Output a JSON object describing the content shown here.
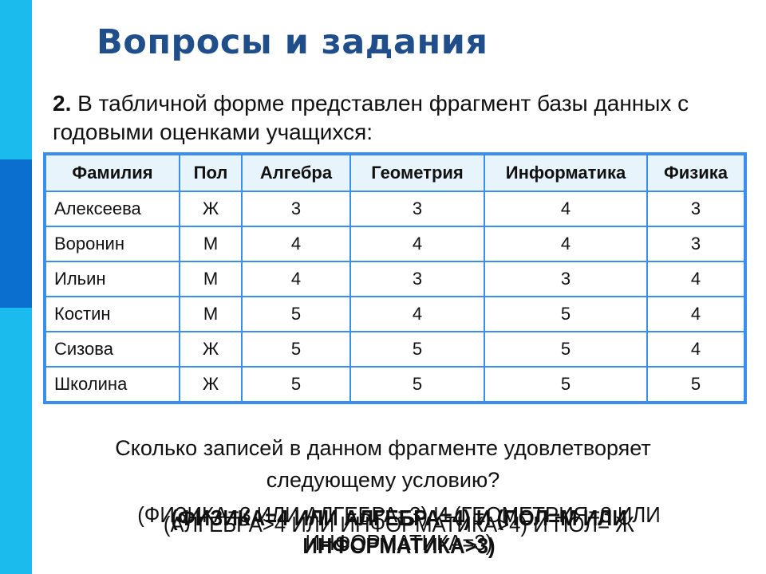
{
  "slide": {
    "title": "Вопросы и задания",
    "task_number": "2.",
    "task_text": " В табличной форме представлен фрагмент базы данных с годовыми оценками учащихся:"
  },
  "colors": {
    "side_bar": "#1cbbee",
    "side_block": "#0a6fce",
    "title": "#1f4e8a",
    "table_border": "#3a8ef0",
    "table_header_bg": "#e8f4fc"
  },
  "table": {
    "headers": [
      "Фамилия",
      "Пол",
      "Алгебра",
      "Геометрия",
      "Информатика",
      "Физика"
    ],
    "rows": [
      [
        "Алексеева",
        "Ж",
        "3",
        "3",
        "4",
        "3"
      ],
      [
        "Воронин",
        "М",
        "4",
        "4",
        "4",
        "3"
      ],
      [
        "Ильин",
        "М",
        "4",
        "3",
        "3",
        "4"
      ],
      [
        "Костин",
        "М",
        "5",
        "4",
        "5",
        "4"
      ],
      [
        "Сизова",
        "Ж",
        "5",
        "5",
        "5",
        "4"
      ],
      [
        "Школина",
        "Ж",
        "5",
        "5",
        "5",
        "5"
      ]
    ]
  },
  "question": {
    "line1": "Сколько записей в данном фрагменте удовлетворяет",
    "line2": "следующему условию?"
  },
  "conditions": [
    {
      "line1": "(ФИЗИКА=3 ИЛИ АЛГЕБРА=3) И (ГЕОМЕТРИЯ=3 ИЛИ",
      "line2": "ИНФОРМАТИКА=3)"
    },
    {
      "line1": "(АЛГЕБРА>4 ИЛИ ИНФОРМАТИКА>4) И ПОЛ= Ж",
      "line2": ""
    },
    {
      "line1": "(ФИЗИКА=4 ИЛИ АЛГЕБРА=4) И (ПОЛ=М ИЛИ",
      "line2": "ИНФОРМАТИКА>3)"
    }
  ]
}
